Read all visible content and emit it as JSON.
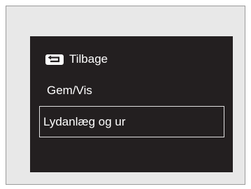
{
  "menu": {
    "back": {
      "label": "Tilbage",
      "icon": "return-arrow-icon"
    },
    "items": [
      {
        "label": "Gem/Vis"
      },
      {
        "label": "Lydanlæg og ur",
        "selected": true
      }
    ]
  }
}
